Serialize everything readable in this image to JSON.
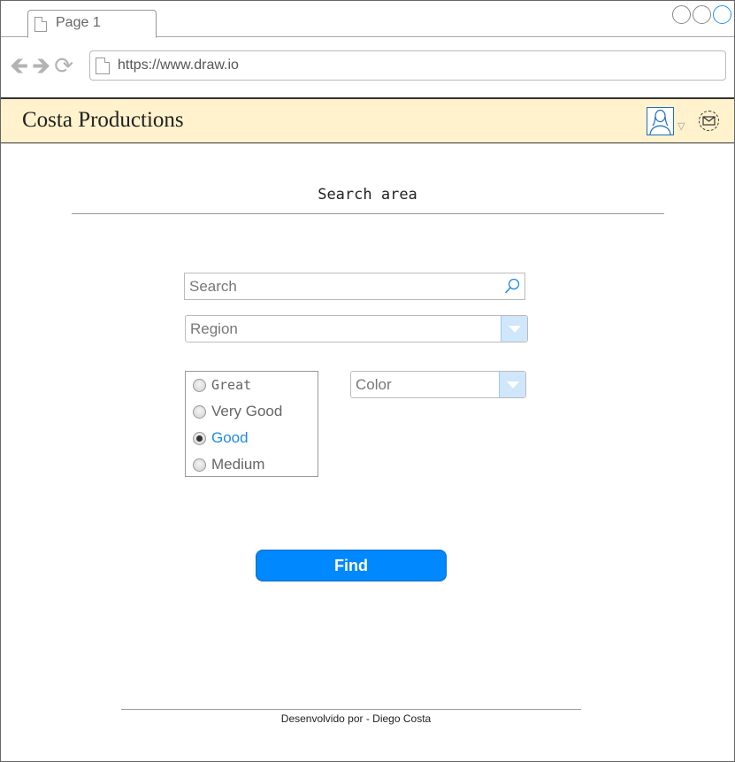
{
  "browser": {
    "tab_label": "Page 1",
    "url": "https://www.draw.io"
  },
  "header": {
    "brand": "Costa Productions"
  },
  "main": {
    "section_title": "Search area",
    "search_placeholder": "Search",
    "region_value": "Region",
    "color_value": "Color",
    "rating_options": [
      {
        "label": "Great",
        "selected": false
      },
      {
        "label": "Very Good",
        "selected": false
      },
      {
        "label": "Good",
        "selected": true
      },
      {
        "label": "Medium",
        "selected": false
      }
    ],
    "find_label": "Find"
  },
  "footer": {
    "credit": "Desenvolvido por - Diego Costa"
  },
  "colors": {
    "header_bg": "#fff2cc",
    "primary_button": "#0088ff",
    "selected_text": "#1e8ae6"
  }
}
